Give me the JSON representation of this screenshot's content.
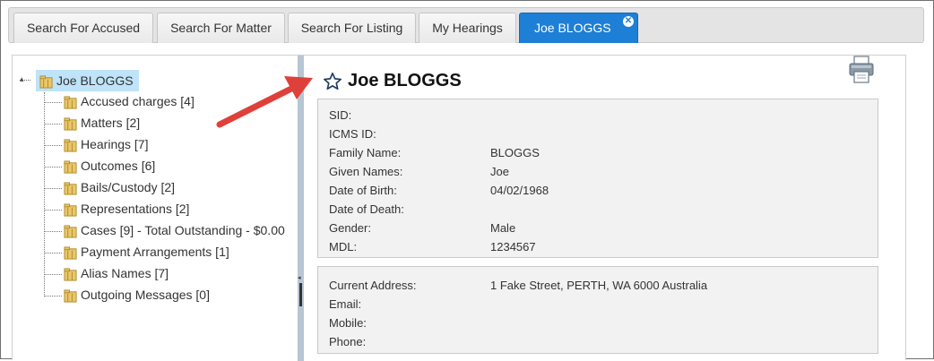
{
  "tabs": [
    {
      "label": "Search For Accused",
      "active": false
    },
    {
      "label": "Search For Matter",
      "active": false
    },
    {
      "label": "Search For Listing",
      "active": false
    },
    {
      "label": "My Hearings",
      "active": false
    },
    {
      "label": "Joe BLOGGS",
      "active": true,
      "close_glyph": "✕"
    }
  ],
  "tree": {
    "root_label": "Joe BLOGGS",
    "items": [
      {
        "label": "Accused charges [4]"
      },
      {
        "label": "Matters [2]"
      },
      {
        "label": "Hearings [7]"
      },
      {
        "label": "Outcomes [6]"
      },
      {
        "label": "Bails/Custody [2]"
      },
      {
        "label": "Representations [2]"
      },
      {
        "label": "Cases [9] - Total Outstanding - $0.00"
      },
      {
        "label": "Payment Arrangements [1]"
      },
      {
        "label": "Alias Names [7]"
      },
      {
        "label": "Outgoing Messages [0]"
      }
    ]
  },
  "detail": {
    "title": "Joe BLOGGS",
    "personal": [
      {
        "label": "SID:",
        "value": ""
      },
      {
        "label": "ICMS ID:",
        "value": ""
      },
      {
        "label": "Family Name:",
        "value": "BLOGGS"
      },
      {
        "label": "Given Names:",
        "value": "Joe"
      },
      {
        "label": "Date of Birth:",
        "value": "04/02/1968"
      },
      {
        "label": "Date of Death:",
        "value": ""
      },
      {
        "label": "Gender:",
        "value": "Male"
      },
      {
        "label": "MDL:",
        "value": "1234567"
      }
    ],
    "contact": [
      {
        "label": "Current Address:",
        "value": "1 Fake Street, PERTH, WA 6000 Australia"
      },
      {
        "label": "Email:",
        "value": ""
      },
      {
        "label": "Mobile:",
        "value": ""
      },
      {
        "label": "Phone:",
        "value": ""
      }
    ]
  },
  "colors": {
    "active_tab": "#1e7fd6",
    "selected_tree_node": "#bfe3f8",
    "annotation_arrow": "#e0403a"
  },
  "icons": [
    "folder-icon",
    "star-icon",
    "printer-icon",
    "close-icon",
    "annotation-arrow"
  ]
}
